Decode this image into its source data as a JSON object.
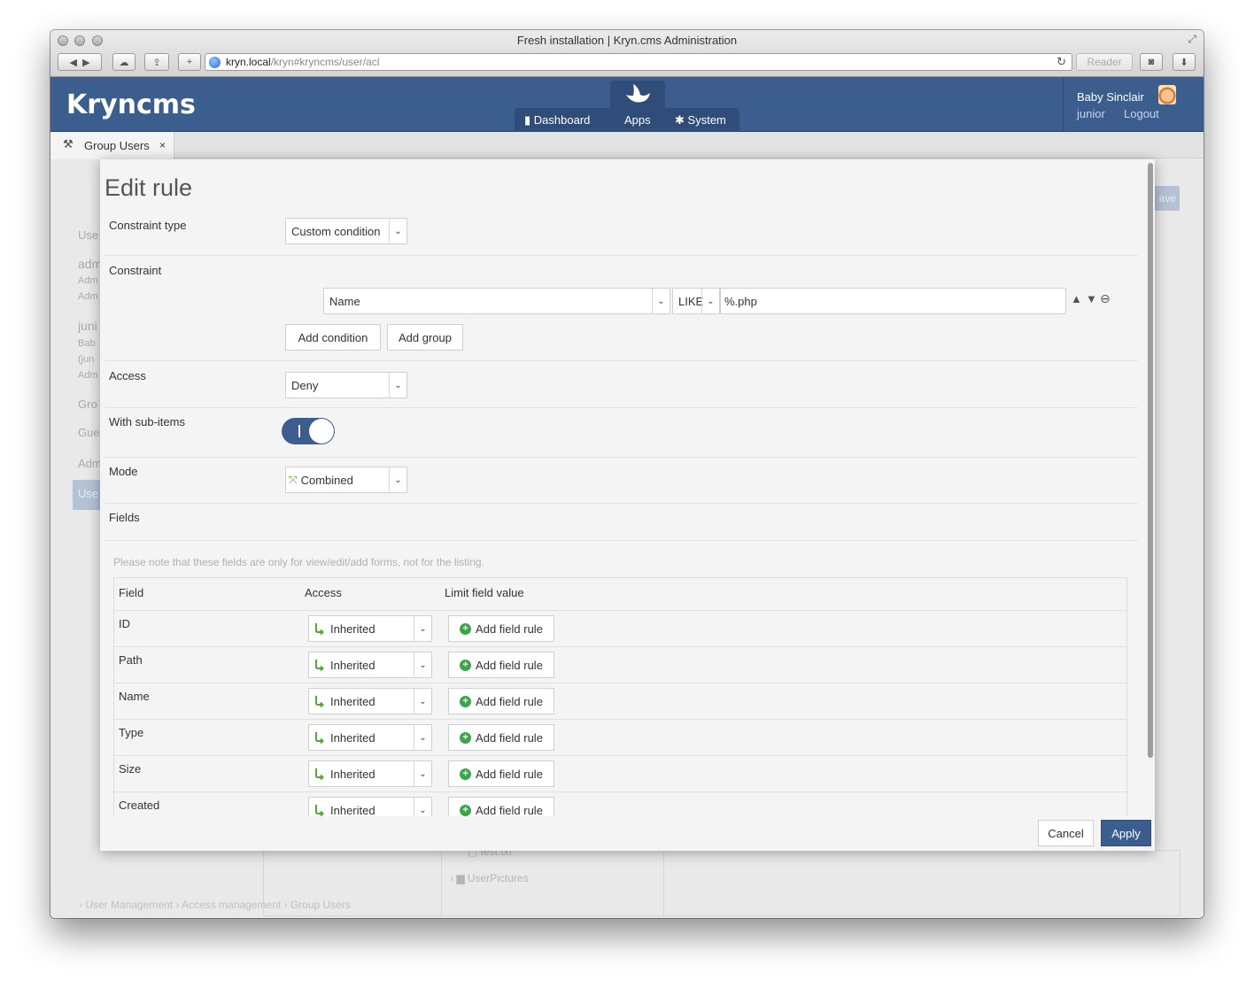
{
  "browser": {
    "title": "Fresh installation | Kryn.cms Administration",
    "url_host": "kryn.local",
    "url_path": "/kryn#kryncms/user/acl",
    "reader_label": "Reader"
  },
  "header": {
    "logo": "Kryncms",
    "nav": [
      {
        "label": "Dashboard",
        "icon": "bar-chart-icon"
      },
      {
        "label": "Apps",
        "icon": "apps-bird-icon"
      },
      {
        "label": "System",
        "icon": "gear-icon"
      }
    ],
    "user": {
      "name": "Baby Sinclair",
      "login": "junior",
      "logout": "Logout"
    }
  },
  "tab": {
    "label": "Group Users",
    "close": "×"
  },
  "background": {
    "sidebar": [
      "Use",
      "adm",
      "Adm",
      "Adm",
      "juni",
      "Bab",
      "(jun",
      "Adm",
      "Gro",
      "Gue",
      "Adm",
      "Use"
    ],
    "save": "ave",
    "files": [
      "test.txt",
      "UserPictures"
    ],
    "breadcrumb": [
      "User Management",
      "Access management",
      "Group Users"
    ]
  },
  "modal": {
    "title": "Edit rule",
    "constraint_type": {
      "label": "Constraint type",
      "value": "Custom condition"
    },
    "constraint": {
      "label": "Constraint",
      "field": "Name",
      "operator": "LIKE",
      "value": "%.php",
      "add_condition": "Add condition",
      "add_group": "Add group"
    },
    "access": {
      "label": "Access",
      "value": "Deny"
    },
    "sub_items": {
      "label": "With sub-items",
      "enabled": true
    },
    "mode": {
      "label": "Mode",
      "value": "Combined"
    },
    "fields": {
      "label": "Fields",
      "note": "Please note that these fields are only for view/edit/add forms, not for the listing.",
      "headers": [
        "Field",
        "Access",
        "Limit field value"
      ],
      "rows": [
        {
          "name": "ID",
          "access": "Inherited",
          "action": "Add field rule"
        },
        {
          "name": "Path",
          "access": "Inherited",
          "action": "Add field rule"
        },
        {
          "name": "Name",
          "access": "Inherited",
          "action": "Add field rule"
        },
        {
          "name": "Type",
          "access": "Inherited",
          "action": "Add field rule"
        },
        {
          "name": "Size",
          "access": "Inherited",
          "action": "Add field rule"
        },
        {
          "name": "Created",
          "access": "Inherited",
          "action": "Add field rule"
        }
      ]
    },
    "cancel": "Cancel",
    "apply": "Apply"
  },
  "colors": {
    "brand": "#3c5e8e",
    "brand_dark": "#2f4d78",
    "add_icon": "#3aa54a",
    "inherited_icon": "#5aa637"
  }
}
